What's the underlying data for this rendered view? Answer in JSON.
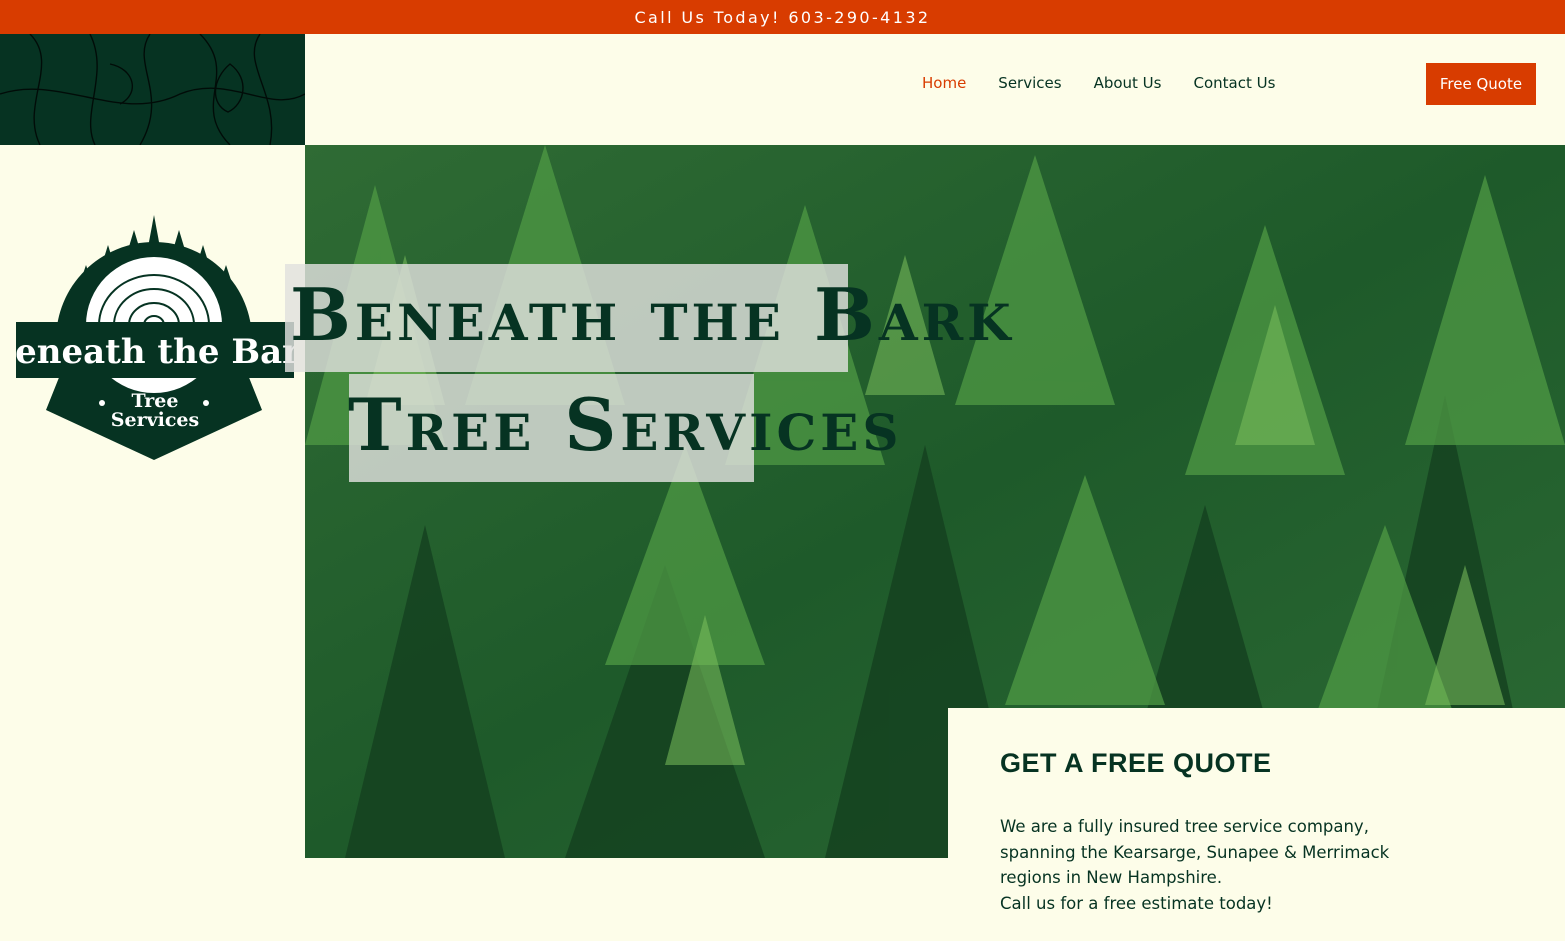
{
  "topbar": {
    "text": "Call Us Today! 603-290-4132"
  },
  "nav": {
    "items": [
      {
        "label": "Home",
        "active": true
      },
      {
        "label": "Services",
        "active": false
      },
      {
        "label": "About Us",
        "active": false
      },
      {
        "label": "Contact Us",
        "active": false
      }
    ]
  },
  "cta": {
    "label": "Free Quote"
  },
  "logo": {
    "name": "Beneath the Bark",
    "sub_line1": "Tree",
    "sub_line2": "Services"
  },
  "hero": {
    "title_line1": "Beneath the Bark",
    "title_line2": "Tree Services"
  },
  "quote_panel": {
    "heading": "GET A FREE QUOTE",
    "body_line1": "We are a fully insured tree service company,",
    "body_line2": "spanning the Kearsarge, Sunapee & Merrimack",
    "body_line3": "regions in New Hampshire.",
    "body_line4": "Call us  for a free estimate today!"
  },
  "colors": {
    "brand_orange": "#d83c00",
    "brand_green": "#063322",
    "background": "#fdfde9"
  }
}
